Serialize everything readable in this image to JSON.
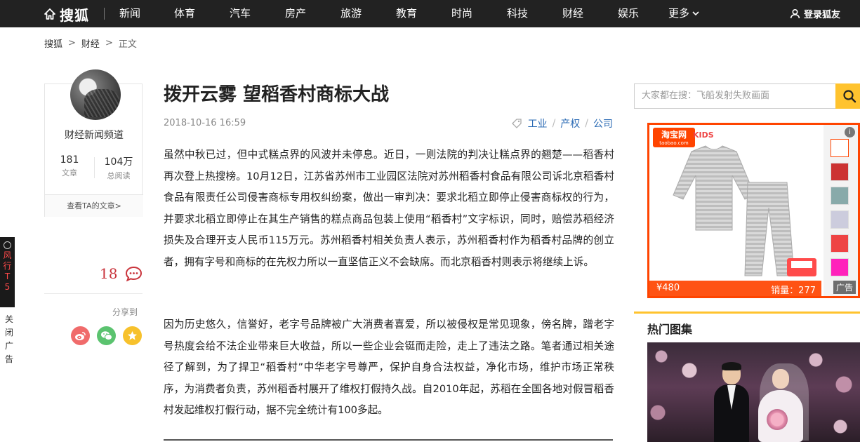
{
  "nav": {
    "logo": "搜狐",
    "items": [
      "新闻",
      "体育",
      "汽车",
      "房产",
      "旅游",
      "教育",
      "时尚",
      "科技",
      "财经",
      "娱乐",
      "更多"
    ],
    "login": "登录狐友"
  },
  "breadcrumb": {
    "home": "搜狐",
    "section": "财经",
    "current": "正文",
    "separator": ">"
  },
  "author": {
    "name": "财经新闻频道",
    "articles_count": "181",
    "articles_label": "文章",
    "reads_count": "104万",
    "reads_label": "总阅读",
    "link": "查看TA的文章>"
  },
  "comments": {
    "count": "18"
  },
  "share": {
    "label": "分享到"
  },
  "side_ad": {
    "text": "风行T5",
    "close": "关闭广告"
  },
  "article": {
    "title": "拨开云雾 望稻香村商标大战",
    "date": "2018-10-16 16:59",
    "tags": [
      "工业",
      "产权",
      "公司"
    ],
    "paragraphs": [
      "虽然中秋已过，但中式糕点界的风波并未停息。近日，一则法院的判决让糕点界的翘楚——稻香村再次登上热搜榜。10月12日，江苏省苏州市工业园区法院对苏州稻香村食品有限公司诉北京稻香村食品有限责任公司侵害商标专用权纠纷案，做出一审判决：要求北稻立即停止侵害商标权的行为，并要求北稻立即停止在其生产销售的糕点商品包装上使用“稻香村”文字标识，同时，赔偿苏稻经济损失及合理开支人民币115万元。苏州稻香村相关负责人表示，苏州稻香村作为稻香村品牌的创立者，拥有字号和商标的在先权力所以一直坚信正义不会缺席。而北京稻香村则表示将继续上诉。",
      "因为历史悠久，信誉好，老字号品牌被广大消费者喜爱，所以被侵权是常见现象，傍名牌，蹭老字号热度会给不法企业带来巨大收益，所以一些企业会铤而走险，走上了违法之路。笔者通过相关途径了解到，为了捍卫“稻香村”中华老字号尊严，保护自身合法权益，净化市场，维护市场正常秩序，为消费者负责，苏州稻香村展开了维权打假持久战。自2010年起，苏稻在全国各地对假冒稻香村发起维权打假行动，据不完全统计有100多起。"
    ]
  },
  "search": {
    "placeholder": "大家都在搜：飞船发射失败画面"
  },
  "ad": {
    "brand": "淘宝网",
    "brand_sub": "taobao.com",
    "kids": "KIDS",
    "price": "¥480",
    "sales": "销量：277",
    "label": "广告",
    "info": "i",
    "up_arrow": "︿"
  },
  "hot": {
    "title": "热门图集"
  },
  "colors": {
    "nav_bg": "#222222",
    "accent": "#ffc32e",
    "link": "#2d6cb5",
    "comment": "#c9333b",
    "ad_border": "#ff4400"
  }
}
